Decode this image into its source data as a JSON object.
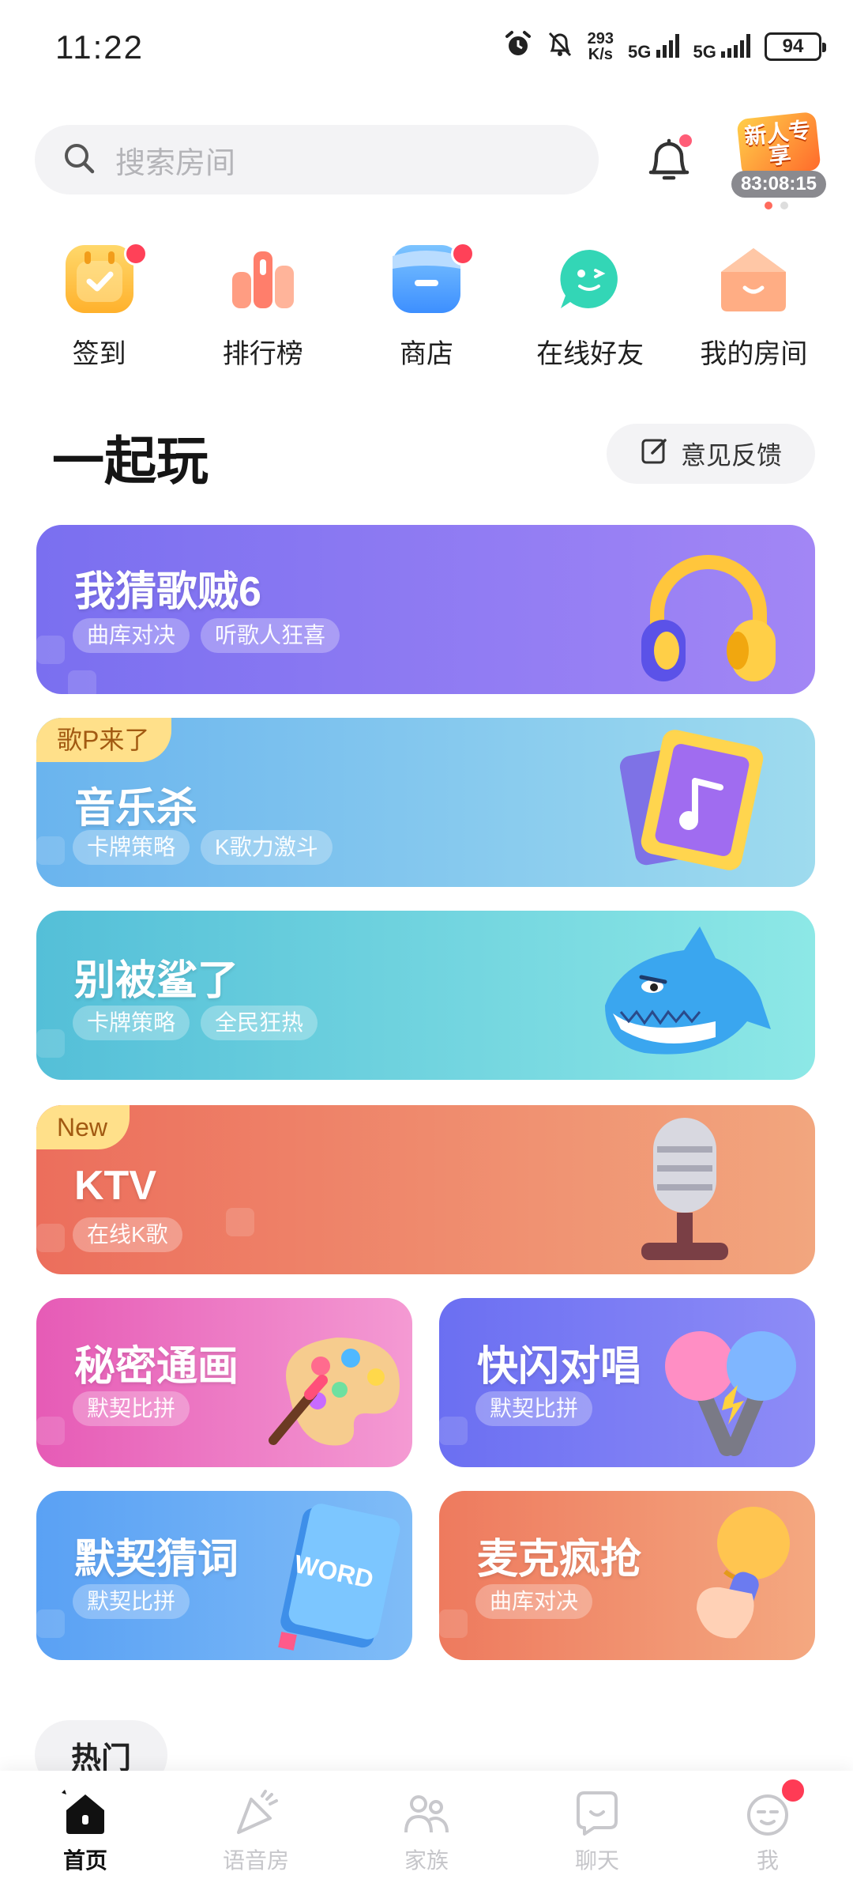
{
  "status_bar": {
    "time": "11:22",
    "speed_top": "293",
    "speed_bottom": "K/s",
    "net1": "5G",
    "net2": "5G",
    "battery": "94"
  },
  "search": {
    "placeholder": "搜索房间"
  },
  "promo": {
    "art_text": "新人专享",
    "timer": "83:08:15"
  },
  "quick_nav": [
    {
      "label": "签到",
      "icon": "calendar-check-icon",
      "color": "#ffc23d",
      "badge": true
    },
    {
      "label": "排行榜",
      "icon": "ranking-icon",
      "color": "#ff8a72",
      "badge": false
    },
    {
      "label": "商店",
      "icon": "shop-icon",
      "color": "#5aa8ff",
      "badge": true
    },
    {
      "label": "在线好友",
      "icon": "chat-face-icon",
      "color": "#2fd1b0",
      "badge": false
    },
    {
      "label": "我的房间",
      "icon": "house-icon",
      "color": "#ff9a6a",
      "badge": false
    }
  ],
  "section": {
    "title": "一起玩",
    "feedback_label": "意见反馈"
  },
  "games": {
    "g1": {
      "name": "我猜歌贼6",
      "tags": [
        "曲库对决",
        "听歌人狂喜"
      ],
      "icon": "headphones-icon"
    },
    "g2": {
      "ribbon": "歌P来了",
      "name": "音乐杀",
      "tags": [
        "卡牌策略",
        "K歌力激斗"
      ],
      "icon": "music-card-icon"
    },
    "g3": {
      "name": "别被鲨了",
      "tags": [
        "卡牌策略",
        "全民狂热"
      ],
      "icon": "shark-icon"
    },
    "g4": {
      "ribbon": "New",
      "name": "KTV",
      "tags": [
        "在线K歌"
      ],
      "icon": "microphone-icon"
    },
    "g5": {
      "name": "秘密通画",
      "tags": [
        "默契比拼"
      ],
      "icon": "palette-icon"
    },
    "g6": {
      "name": "快闪对唱",
      "tags": [
        "默契比拼"
      ],
      "icon": "double-mic-icon"
    },
    "g7": {
      "name": "默契猜词",
      "tags": [
        "默契比拼"
      ],
      "icon": "word-book-icon",
      "book_text": "WORD"
    },
    "g8": {
      "name": "麦克疯抢",
      "tags": [
        "曲库对决"
      ],
      "icon": "hand-mic-icon"
    }
  },
  "hot_chip": "热门",
  "tabs": [
    {
      "label": "首页",
      "icon": "home-icon",
      "active": true
    },
    {
      "label": "语音房",
      "icon": "party-icon",
      "active": false
    },
    {
      "label": "家族",
      "icon": "family-icon",
      "active": false
    },
    {
      "label": "聊天",
      "icon": "chat-icon",
      "active": false
    },
    {
      "label": "我",
      "icon": "profile-face-icon",
      "active": false,
      "badge": true
    }
  ],
  "colors": {
    "accent": "#ff4158",
    "card1": "#8f7af0",
    "card2": "#79c6ee",
    "card3": "#5fd3dc",
    "card4": "#f0866a"
  }
}
